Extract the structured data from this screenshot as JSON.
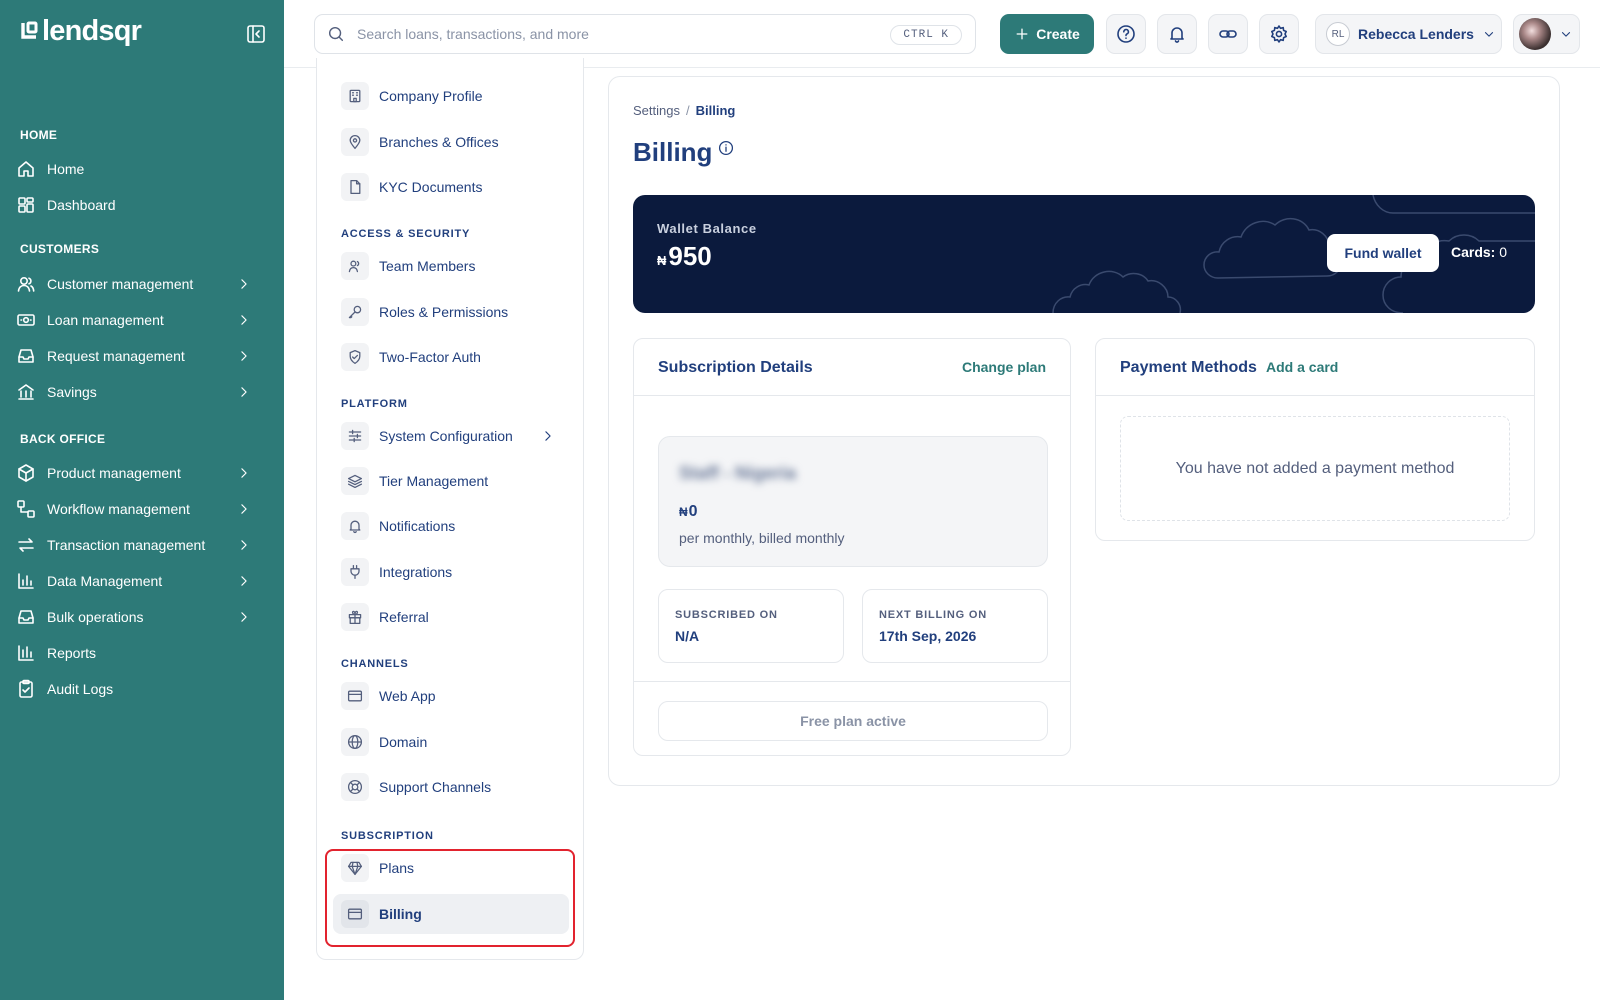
{
  "app": {
    "brand": "lendsqr",
    "accent": "#2d7a78",
    "navy": "#213f7d"
  },
  "sidebar": {
    "sections": [
      {
        "title": "HOME",
        "items": [
          {
            "label": "Home",
            "icon": "home-icon"
          },
          {
            "label": "Dashboard",
            "icon": "dashboard-icon"
          }
        ]
      },
      {
        "title": "CUSTOMERS",
        "items": [
          {
            "label": "Customer management"
          },
          {
            "label": "Loan management"
          },
          {
            "label": "Request management"
          },
          {
            "label": "Savings"
          }
        ]
      },
      {
        "title": "BACK OFFICE",
        "items": [
          {
            "label": "Product management"
          },
          {
            "label": "Workflow management"
          },
          {
            "label": "Transaction management"
          },
          {
            "label": "Data Management"
          },
          {
            "label": "Bulk operations"
          },
          {
            "label": "Reports"
          },
          {
            "label": "Audit Logs"
          }
        ]
      }
    ]
  },
  "header": {
    "search_placeholder": "Search loans, transactions, and more",
    "shortcut": "CTRL K",
    "create_label": "Create",
    "user_initials": "RL",
    "user_name": "Rebecca Lenders"
  },
  "settings_nav": {
    "top_items": [
      "Company Profile",
      "Branches & Offices",
      "KYC Documents"
    ],
    "groups": [
      {
        "title": "ACCESS & SECURITY",
        "items": [
          "Team Members",
          "Roles & Permissions",
          "Two-Factor Auth"
        ]
      },
      {
        "title": "PLATFORM",
        "items": [
          "System Configuration",
          "Tier Management",
          "Notifications",
          "Integrations",
          "Referral"
        ]
      },
      {
        "title": "CHANNELS",
        "items": [
          "Web App",
          "Domain",
          "Support Channels"
        ]
      },
      {
        "title": "SUBSCRIPTION",
        "items": [
          "Plans",
          "Billing"
        ]
      }
    ],
    "active": "Billing"
  },
  "main": {
    "breadcrumb": {
      "parent": "Settings",
      "separator": "/",
      "current": "Billing"
    },
    "title": "Billing",
    "wallet": {
      "label": "Wallet Balance",
      "currency": "₦",
      "balance": "950",
      "fund_label": "Fund wallet",
      "cards_label": "Cards:",
      "cards_count": "0"
    },
    "subscription": {
      "title": "Subscription Details",
      "change_label": "Change plan",
      "plan_name": "Staff - Nigeria",
      "price_currency": "₦",
      "price": "0",
      "cycle": "per monthly, billed monthly",
      "subscribed_label": "SUBSCRIBED ON",
      "subscribed_value": "N/A",
      "next_label": "NEXT BILLING ON",
      "next_value": "17th Sep, 2026",
      "status": "Free plan active"
    },
    "payment": {
      "title": "Payment Methods",
      "add_label": "Add a card",
      "empty": "You have not added a payment method"
    }
  }
}
